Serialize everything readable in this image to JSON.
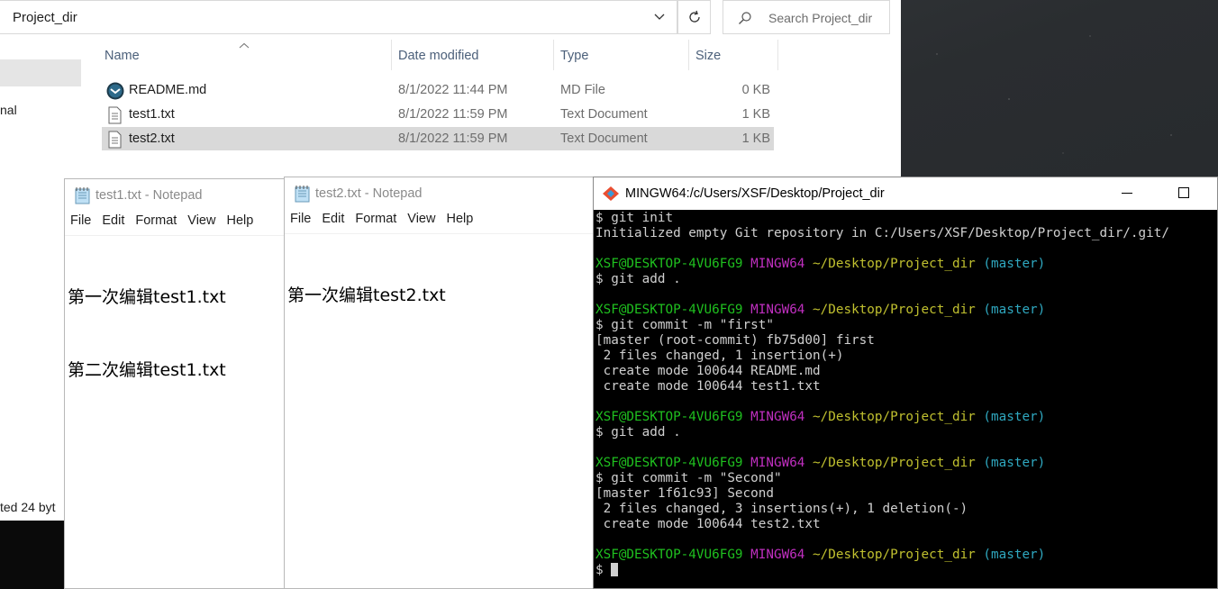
{
  "explorer": {
    "address": "Project_dir",
    "search_placeholder": "Search Project_dir",
    "nav_fragment": "nal",
    "status_text": "ted  24 byt",
    "columns": {
      "name": "Name",
      "date": "Date modified",
      "type": "Type",
      "size": "Size"
    },
    "files": [
      {
        "name": "README.md",
        "date": "8/1/2022 11:44 PM",
        "type": "MD File",
        "size": "0 KB",
        "icon": "markdown-app-icon"
      },
      {
        "name": "test1.txt",
        "date": "8/1/2022 11:59 PM",
        "type": "Text Document",
        "size": "1 KB",
        "icon": "text-file-icon"
      },
      {
        "name": "test2.txt",
        "date": "8/1/2022 11:59 PM",
        "type": "Text Document",
        "size": "1 KB",
        "icon": "text-file-icon",
        "selected": true
      }
    ]
  },
  "notepad1": {
    "title": "test1.txt - Notepad",
    "menu": [
      "File",
      "Edit",
      "Format",
      "View",
      "Help"
    ],
    "lines": [
      "第一次编辑test1.txt",
      "第二次编辑test1.txt"
    ]
  },
  "notepad2": {
    "title": "test2.txt - Notepad",
    "menu": [
      "File",
      "Edit",
      "Format",
      "View",
      "Help"
    ],
    "lines": [
      "第一次编辑test2.txt"
    ]
  },
  "terminal": {
    "title": "MINGW64:/c/Users/XSF/Desktop/Project_dir",
    "prompt": {
      "user": "XSF@DESKTOP-4VU6FG9",
      "env": "MINGW64",
      "path": "~/Desktop/Project_dir",
      "branch": "(master)"
    },
    "lines": [
      {
        "kind": "cmd",
        "text": "$ git init"
      },
      {
        "kind": "out",
        "text": "Initialized empty Git repository in C:/Users/XSF/Desktop/Project_dir/.git/"
      },
      {
        "kind": "blank",
        "text": ""
      },
      {
        "kind": "prompt",
        "text": ""
      },
      {
        "kind": "cmd",
        "text": "$ git add ."
      },
      {
        "kind": "blank",
        "text": ""
      },
      {
        "kind": "prompt",
        "text": ""
      },
      {
        "kind": "cmd",
        "text": "$ git commit -m \"first\""
      },
      {
        "kind": "out",
        "text": "[master (root-commit) fb75d00] first"
      },
      {
        "kind": "out",
        "text": " 2 files changed, 1 insertion(+)"
      },
      {
        "kind": "out",
        "text": " create mode 100644 README.md"
      },
      {
        "kind": "out",
        "text": " create mode 100644 test1.txt"
      },
      {
        "kind": "blank",
        "text": ""
      },
      {
        "kind": "prompt",
        "text": ""
      },
      {
        "kind": "cmd",
        "text": "$ git add ."
      },
      {
        "kind": "blank",
        "text": ""
      },
      {
        "kind": "prompt",
        "text": ""
      },
      {
        "kind": "cmd",
        "text": "$ git commit -m \"Second\""
      },
      {
        "kind": "out",
        "text": "[master 1f61c93] Second"
      },
      {
        "kind": "out",
        "text": " 2 files changed, 3 insertions(+), 1 deletion(-)"
      },
      {
        "kind": "out",
        "text": " create mode 100644 test2.txt"
      },
      {
        "kind": "blank",
        "text": ""
      },
      {
        "kind": "prompt",
        "text": ""
      },
      {
        "kind": "cursor",
        "text": "$ "
      }
    ]
  }
}
